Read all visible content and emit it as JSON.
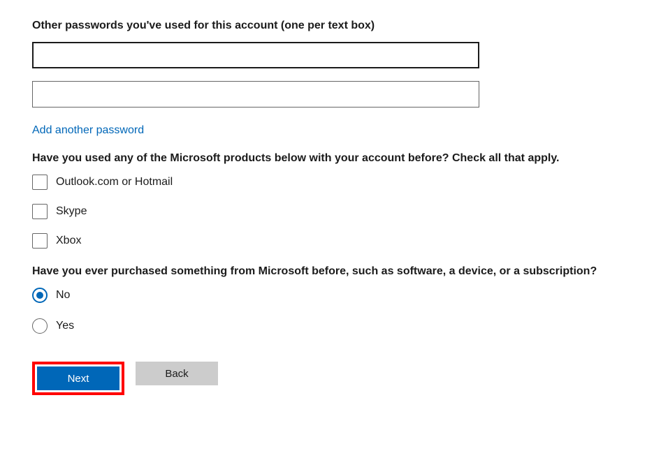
{
  "passwords": {
    "label": "Other passwords you've used for this account (one per text box)",
    "field1": "",
    "field2": "",
    "add_link": "Add another password"
  },
  "products": {
    "label": "Have you used any of the Microsoft products below with your account before? Check all that apply.",
    "options": [
      {
        "label": "Outlook.com or Hotmail",
        "checked": false
      },
      {
        "label": "Skype",
        "checked": false
      },
      {
        "label": "Xbox",
        "checked": false
      }
    ]
  },
  "purchase": {
    "label": "Have you ever purchased something from Microsoft before, such as software, a device, or a subscription?",
    "options": [
      {
        "label": "No",
        "selected": true
      },
      {
        "label": "Yes",
        "selected": false
      }
    ]
  },
  "buttons": {
    "next": "Next",
    "back": "Back"
  },
  "colors": {
    "accent": "#0067b8",
    "highlight": "#ff0000"
  }
}
